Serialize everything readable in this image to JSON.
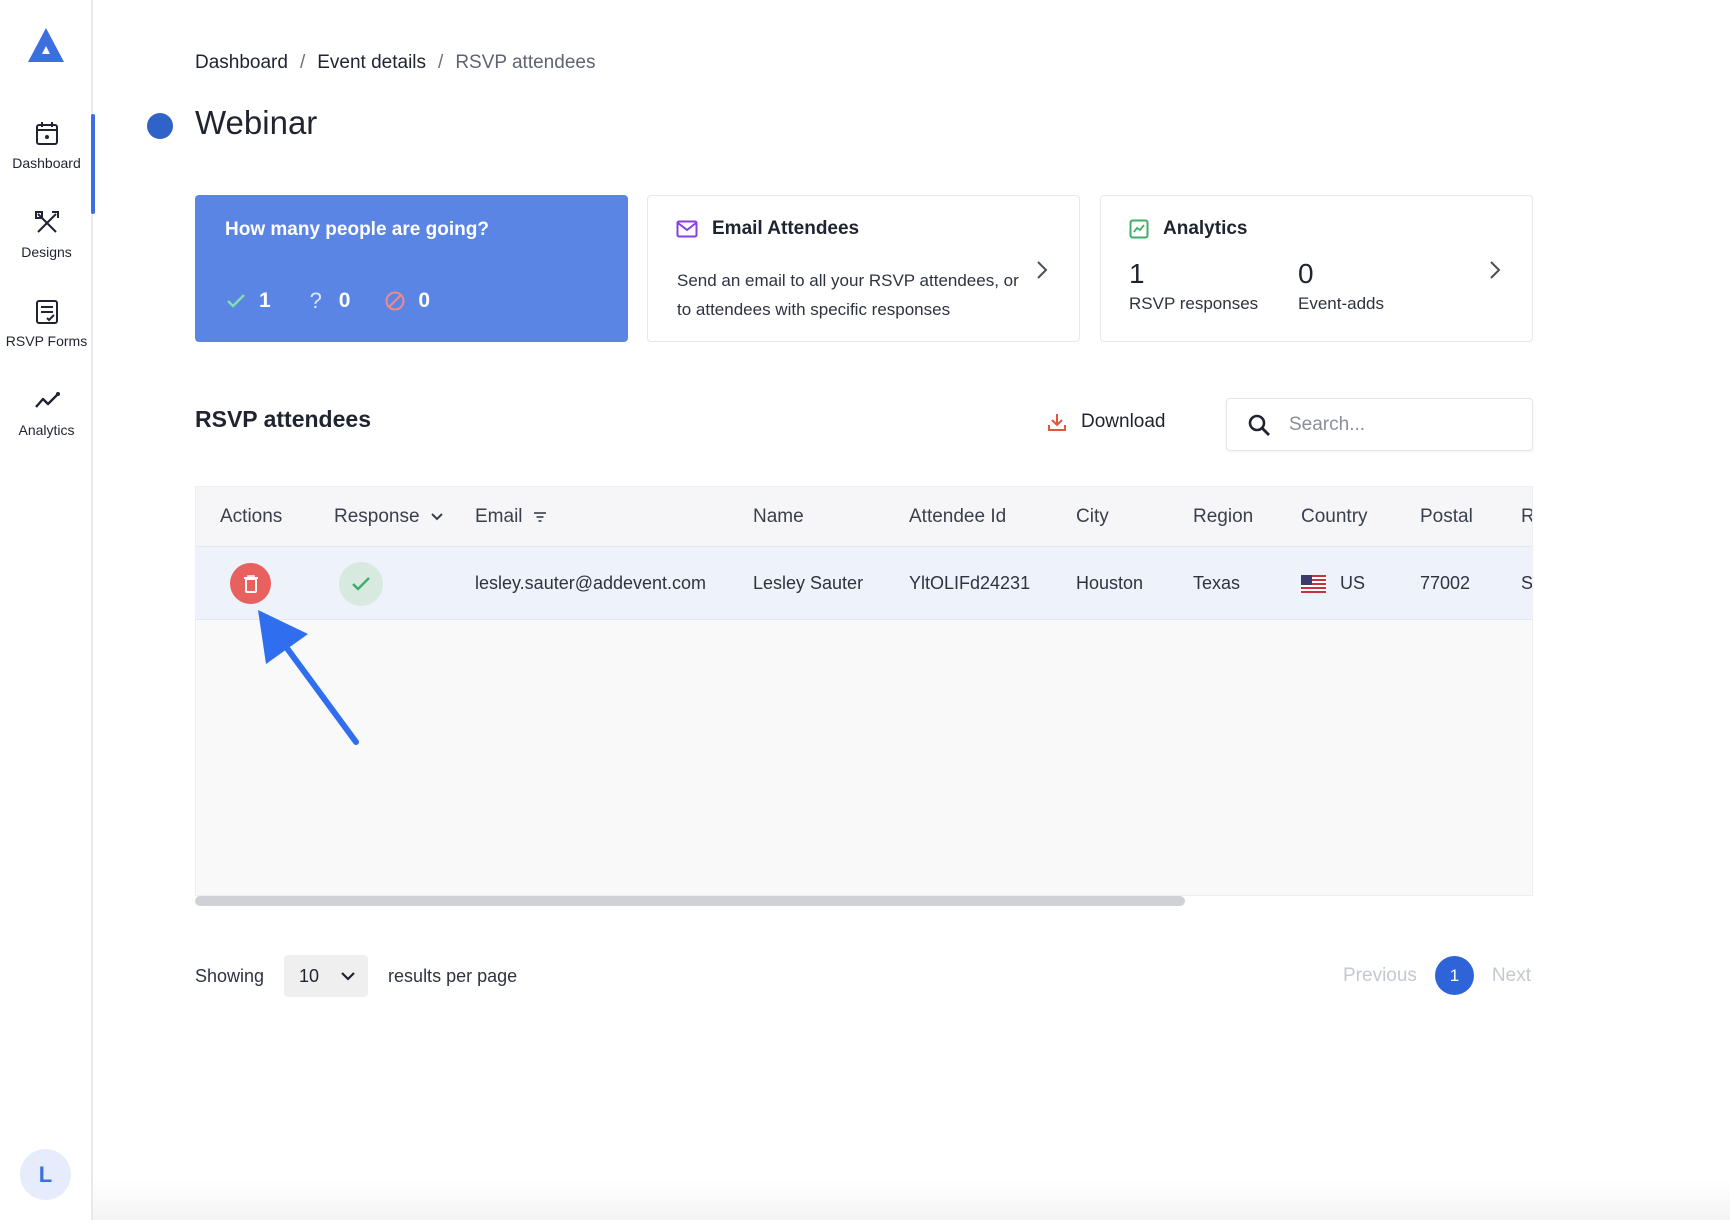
{
  "sidebar": {
    "items": [
      {
        "label": "Dashboard",
        "icon": "calendar-icon"
      },
      {
        "label": "Designs",
        "icon": "designs-icon"
      },
      {
        "label": "RSVP Forms",
        "icon": "form-icon"
      },
      {
        "label": "Analytics",
        "icon": "chart-line-icon"
      }
    ],
    "avatar_initial": "L"
  },
  "breadcrumb": {
    "items": [
      "Dashboard",
      "Event details",
      "RSVP attendees"
    ],
    "separator": "/"
  },
  "page": {
    "title": "Webinar",
    "title_dot_color": "#2f63c8"
  },
  "cards": {
    "going": {
      "title": "How many people are going?",
      "yes_count": "1",
      "maybe_count": "0",
      "no_count": "0"
    },
    "email": {
      "title": "Email Attendees",
      "description": "Send an email to all your RSVP attendees, or to attendees with specific responses"
    },
    "analytics": {
      "title": "Analytics",
      "rsvp_value": "1",
      "rsvp_label": "RSVP responses",
      "event_adds_value": "0",
      "event_adds_label": "Event-adds"
    }
  },
  "section": {
    "title": "RSVP attendees",
    "download_label": "Download",
    "search_placeholder": "Search..."
  },
  "table": {
    "columns": [
      "Actions",
      "Response",
      "Email",
      "Name",
      "Attendee Id",
      "City",
      "Region",
      "Country",
      "Postal",
      "Re"
    ],
    "rows": [
      {
        "response": "yes",
        "email": "lesley.sauter@addevent.com",
        "name": "Lesley Sauter",
        "attendee_id": "YltOLIFd24231",
        "city": "Houston",
        "region": "Texas",
        "country": "US",
        "postal": "77002",
        "extra": "Se"
      }
    ]
  },
  "footer": {
    "showing_label": "Showing",
    "per_page_value": "10",
    "per_page_suffix": "results per page",
    "previous_label": "Previous",
    "current_page": "1",
    "next_label": "Next"
  },
  "colors": {
    "accent": "#3b6fe0",
    "card_blue": "#5b85e5",
    "delete_red": "#e8615e",
    "success_green": "#3fae6a"
  }
}
